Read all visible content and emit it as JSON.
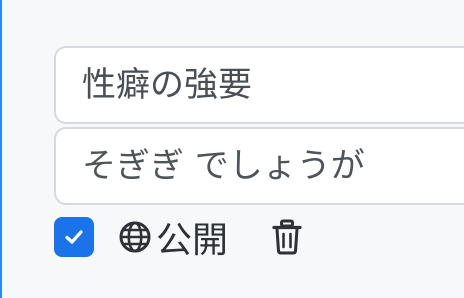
{
  "form": {
    "title_value": "性癖の強要",
    "description_value": "そぎぎ でしょうが"
  },
  "controls": {
    "checkbox_checked": true,
    "visibility_label": "公開",
    "icons": {
      "checkbox": "check-icon",
      "visibility": "globe-icon",
      "delete": "trash-icon"
    }
  },
  "colors": {
    "accent": "#1a73e8",
    "left_edge": "#2f86f6",
    "background": "#f7f8fa"
  }
}
